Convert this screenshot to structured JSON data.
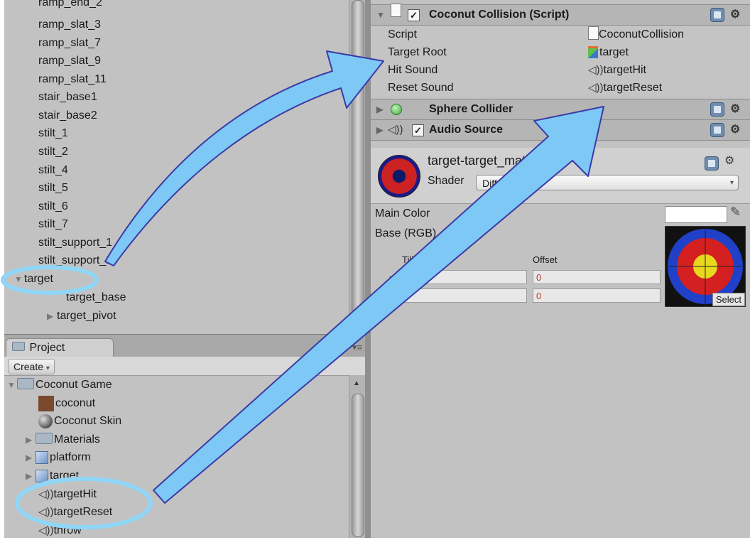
{
  "hierarchy": {
    "items": [
      {
        "label": "ramp_end_2"
      },
      {
        "label": "ramp_slat_3"
      },
      {
        "label": "ramp_slat_7"
      },
      {
        "label": "ramp_slat_9"
      },
      {
        "label": "ramp_slat_11"
      },
      {
        "label": "stair_base1"
      },
      {
        "label": "stair_base2"
      },
      {
        "label": "stilt_1"
      },
      {
        "label": "stilt_2"
      },
      {
        "label": "stilt_4"
      },
      {
        "label": "stilt_5"
      },
      {
        "label": "stilt_6"
      },
      {
        "label": "stilt_7"
      },
      {
        "label": "stilt_support_1"
      },
      {
        "label": "stilt_support_2"
      },
      {
        "label": "target"
      },
      {
        "label": "target_base"
      },
      {
        "label": "target_pivot"
      }
    ]
  },
  "project": {
    "tab_label": "Project",
    "create_label": "Create",
    "items": [
      {
        "label": "Coconut Game",
        "icon": "folder-icon"
      },
      {
        "label": "coconut",
        "icon": "texture-icon"
      },
      {
        "label": "Coconut Skin",
        "icon": "material-sphere-icon"
      },
      {
        "label": "Materials",
        "icon": "folder-icon"
      },
      {
        "label": "platform",
        "icon": "prefab-icon"
      },
      {
        "label": "target",
        "icon": "prefab-icon"
      },
      {
        "label": "targetHit",
        "icon": "audio-icon"
      },
      {
        "label": "targetReset",
        "icon": "audio-icon"
      },
      {
        "label": "throw",
        "icon": "audio-icon"
      }
    ]
  },
  "inspector": {
    "coconut_collision": {
      "title": "Coconut Collision (Script)",
      "props": [
        {
          "label": "Script",
          "value": "CoconutCollision"
        },
        {
          "label": "Target Root",
          "value": "target"
        },
        {
          "label": "Hit Sound",
          "value": "targetHit"
        },
        {
          "label": "Reset Sound",
          "value": "targetReset"
        }
      ]
    },
    "sphere_collider": {
      "title": "Sphere Collider"
    },
    "audio_source": {
      "title": "Audio Source"
    },
    "material": {
      "name": "target-target_material_2",
      "shader_label": "Shader",
      "shader_value": "Diffuse",
      "main_color_label": "Main Color",
      "base_label": "Base (RGB)",
      "tiling_label": "Tiling",
      "offset_label": "Offset",
      "x_label": "x",
      "tiling_x": "1",
      "offset_x": "0",
      "offset_y": "0",
      "select_label": "Select"
    }
  },
  "colors": {
    "arrow_fill": "#7ec8f5",
    "arrow_stroke": "#3a3aa8",
    "highlight_ring": "#8fd6f7",
    "panel_bg": "#c2c2c2"
  }
}
